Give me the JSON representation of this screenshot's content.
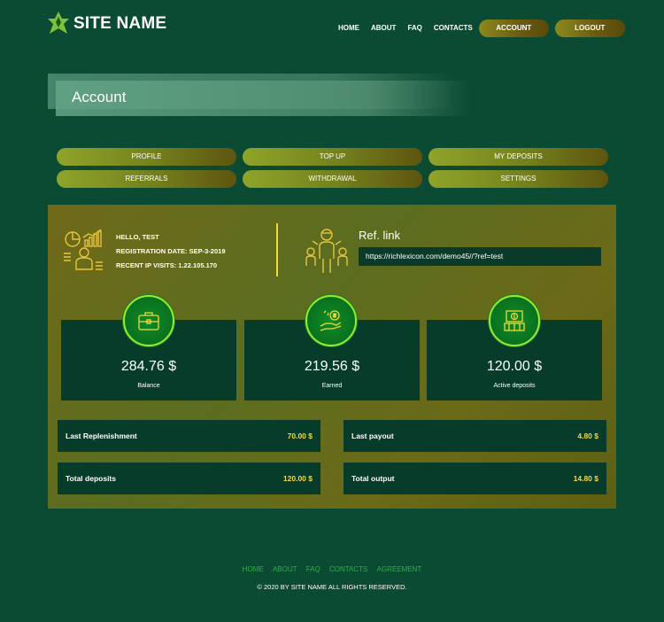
{
  "header": {
    "site_name": "SITE NAME",
    "nav": [
      "HOME",
      "ABOUT",
      "FAQ",
      "CONTACTS"
    ],
    "account_label": "ACCOUNT",
    "logout_label": "LOGOUT"
  },
  "page_title": "Account",
  "tabs": [
    "PROFILE",
    "TOP UP",
    "MY DEPOSITS",
    "REFERRALS",
    "WITHDRAWAL",
    "SETTINGS"
  ],
  "user": {
    "hello": "HELLO, TEST",
    "registration": "REGISTRATION DATE: SEP-3-2019",
    "recent_ip": "RECENT IP VISITS: 1.22.105.170"
  },
  "ref": {
    "title": "Ref. link",
    "url": "https://richlexicon.com/demo45//?ref=test"
  },
  "cards": [
    {
      "amount": "284.76 $",
      "label": "Balance",
      "icon": "briefcase-icon"
    },
    {
      "amount": "219.56 $",
      "label": "Earned",
      "icon": "money-hand-icon"
    },
    {
      "amount": "120.00 $",
      "label": "Active deposits",
      "icon": "cash-register-icon"
    }
  ],
  "stats": [
    {
      "label": "Last Replenishment",
      "value": "70.00 $"
    },
    {
      "label": "Last payout",
      "value": "4.80 $"
    },
    {
      "label": "Total deposits",
      "value": "120.00 $"
    },
    {
      "label": "Total output",
      "value": "14.80 $"
    }
  ],
  "footer": {
    "links": [
      "HOME",
      "ABOUT",
      "FAQ",
      "CONTACTS",
      "AGREEMENT"
    ],
    "copyright": "© 2020 BY SITE NAME ALL RIGHTS RESERVED."
  },
  "colors": {
    "background": "#0b4a33",
    "accent_yellow": "#f2d83a",
    "green_glow": "#8ef031",
    "card": "#073c2a"
  }
}
